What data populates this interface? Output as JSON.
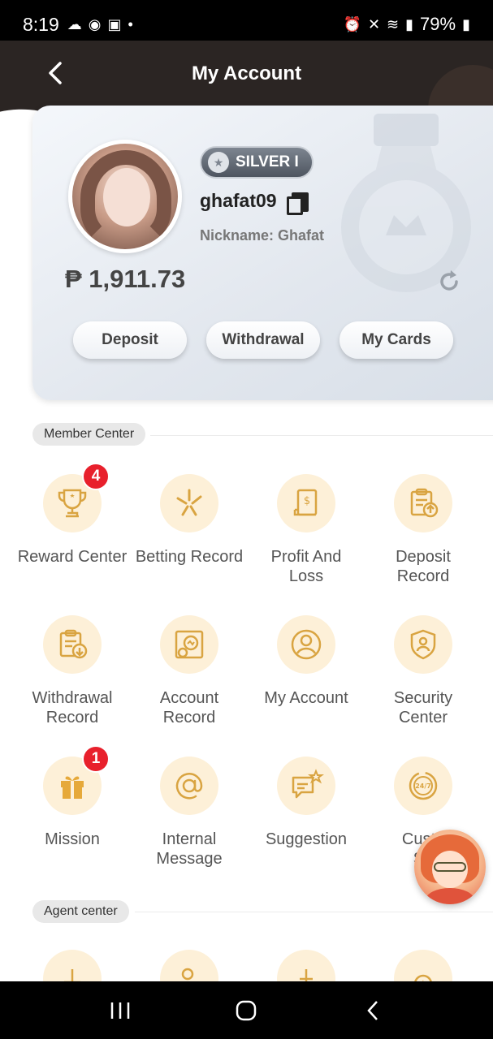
{
  "status_bar": {
    "time": "8:19",
    "battery": "79%"
  },
  "header": {
    "title": "My Account"
  },
  "account": {
    "rank": "SILVER I",
    "username": "ghafat09",
    "nickname": "Nickname: Ghafat",
    "balance": "₱ 1,911.73",
    "buttons": {
      "deposit": "Deposit",
      "withdrawal": "Withdrawal",
      "my_cards": "My Cards"
    }
  },
  "member_center": {
    "tag": "Member Center",
    "items": [
      {
        "label": "Reward Center",
        "icon": "trophy-icon",
        "badge": "4"
      },
      {
        "label": "Betting Record",
        "icon": "betting-icon"
      },
      {
        "label": "Profit And\nLoss",
        "icon": "receipt-icon"
      },
      {
        "label": "Deposit\nRecord",
        "icon": "clipboard-upload-icon"
      },
      {
        "label": "Withdrawal\nRecord",
        "icon": "clipboard-download-icon"
      },
      {
        "label": "Account\nRecord",
        "icon": "account-record-icon"
      },
      {
        "label": "My Account",
        "icon": "user-icon"
      },
      {
        "label": "Security\nCenter",
        "icon": "shield-icon"
      },
      {
        "label": "Mission",
        "icon": "gift-icon",
        "badge": "1"
      },
      {
        "label": "Internal\nMessage",
        "icon": "at-icon"
      },
      {
        "label": "Suggestion",
        "icon": "chat-star-icon"
      },
      {
        "label": "Custo\nSe",
        "icon": "24-7-icon"
      }
    ]
  },
  "agent_center": {
    "tag": "Agent center"
  },
  "colors": {
    "accent_gold": "#d9a441",
    "icon_bg": "#fdf0d8",
    "badge_red": "#e8202c",
    "header_dark": "#2b2523"
  }
}
